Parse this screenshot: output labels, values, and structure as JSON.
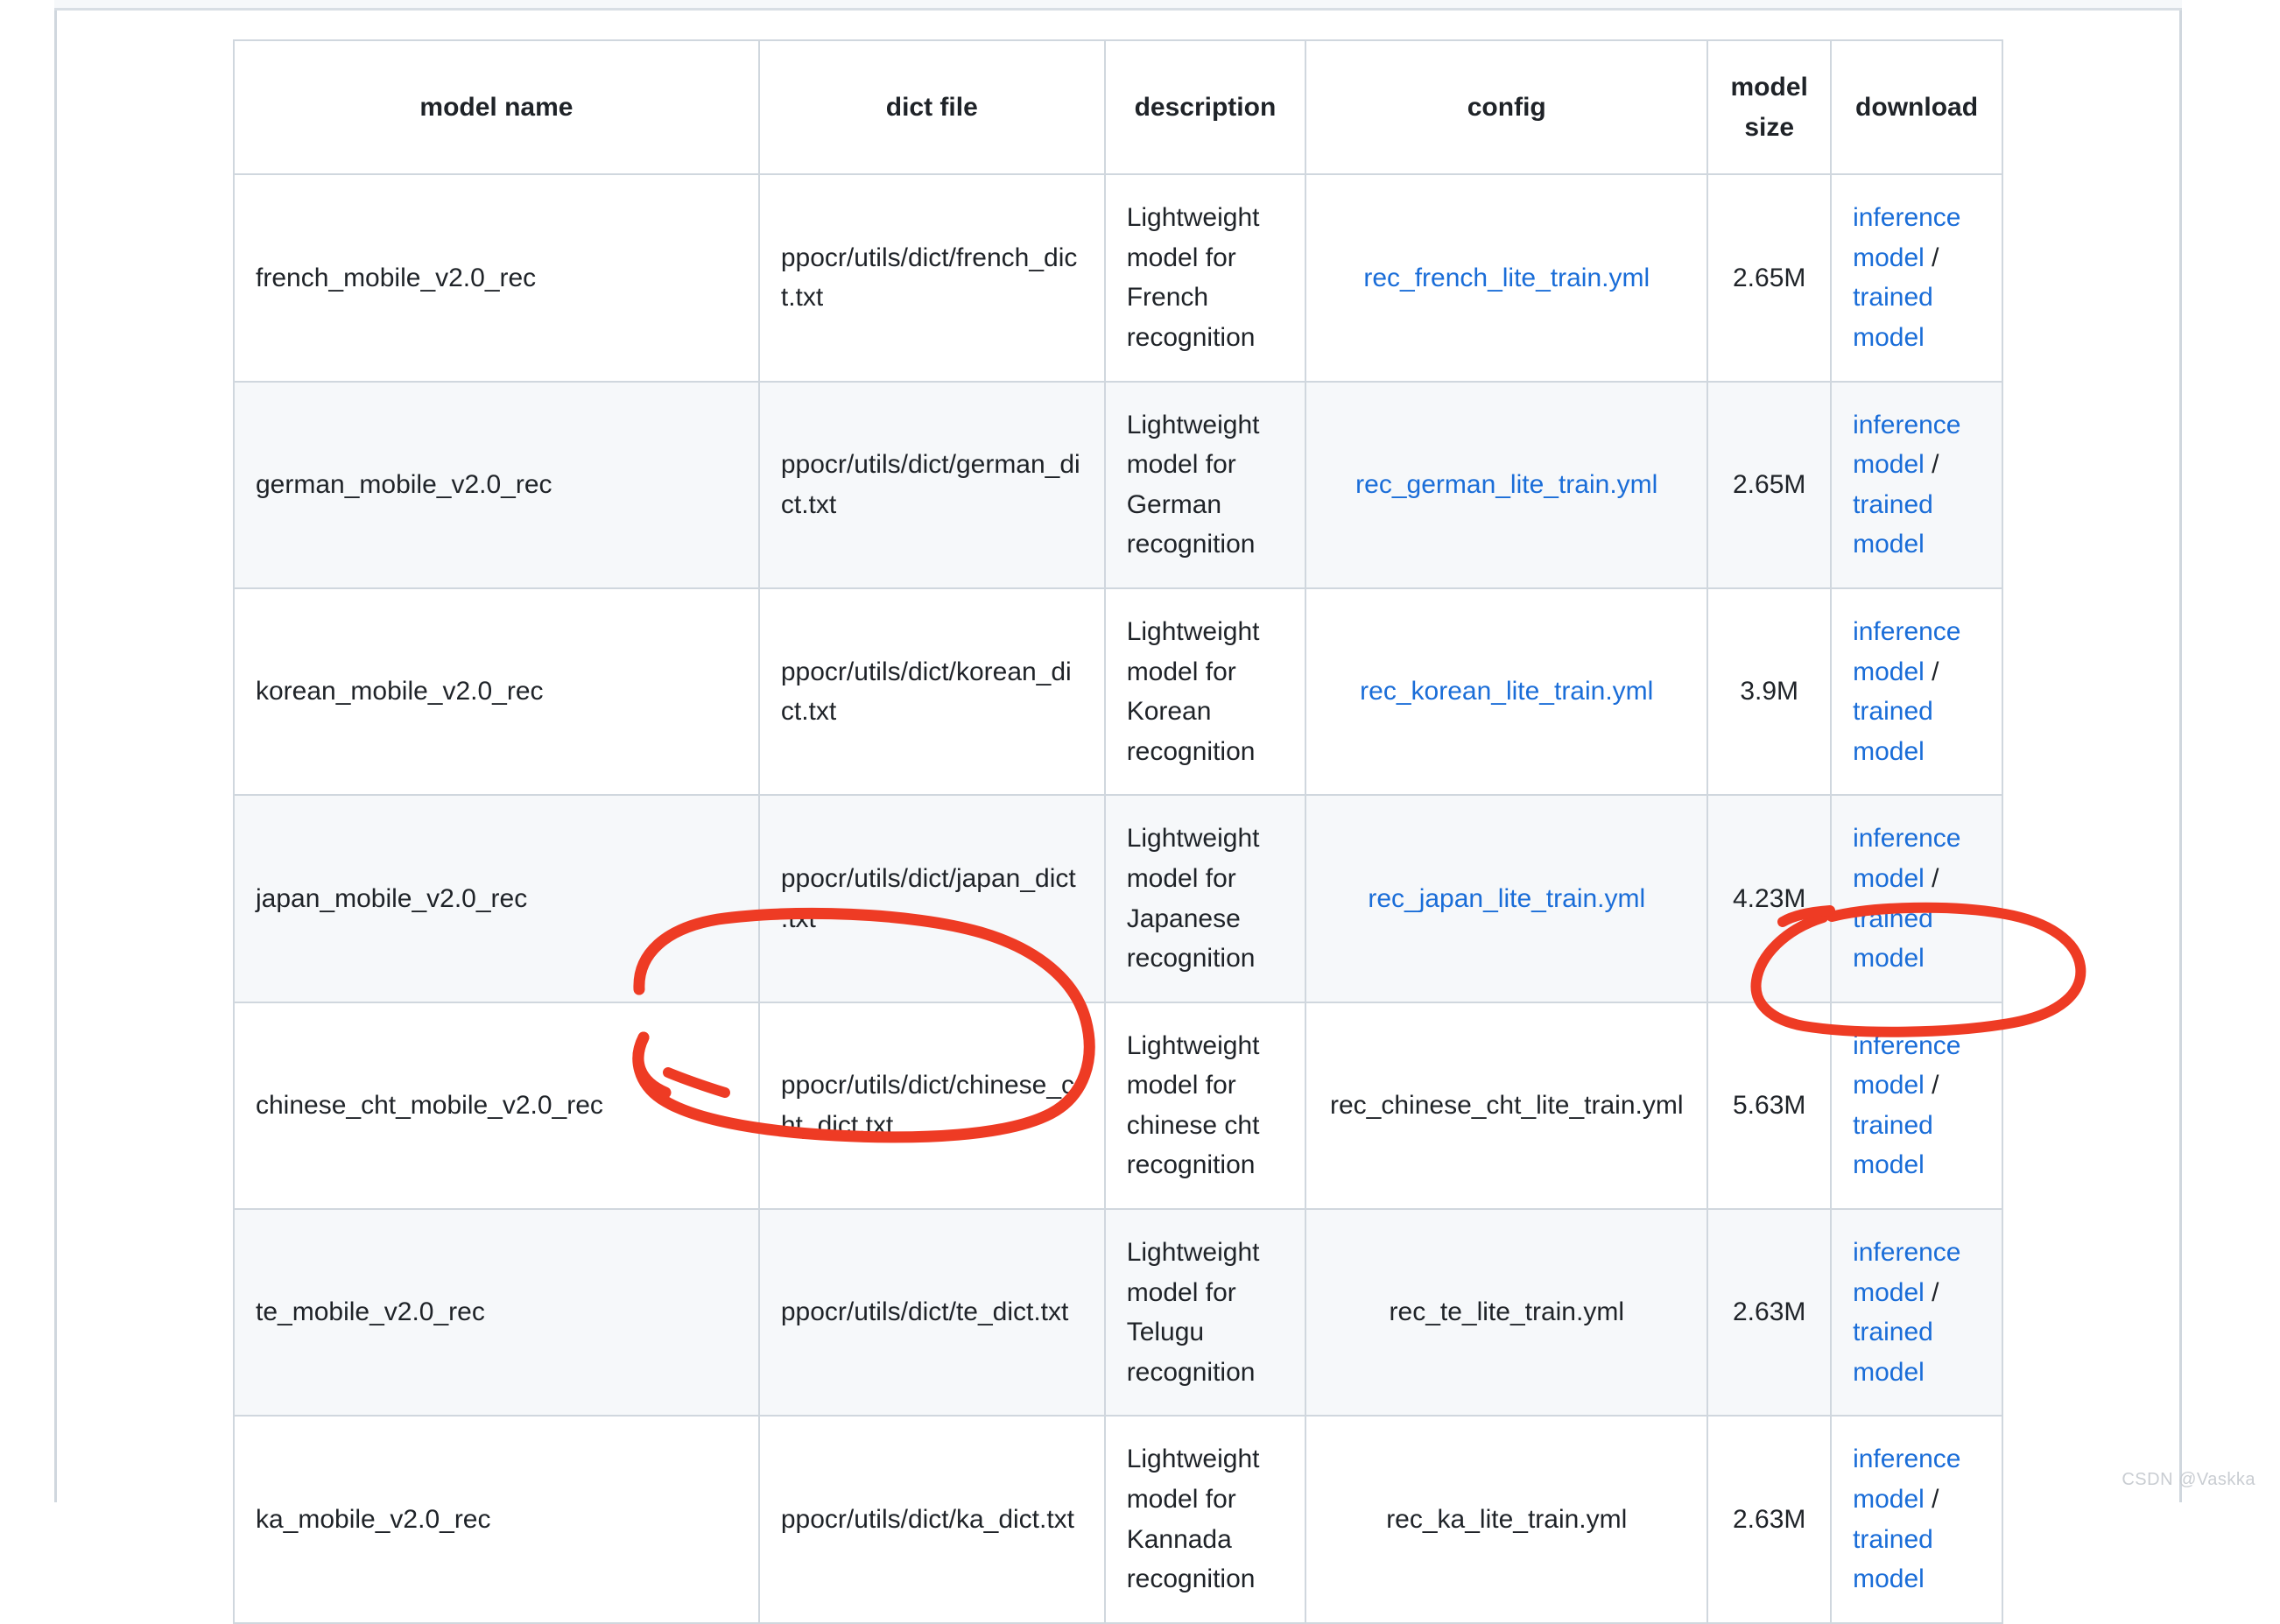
{
  "table": {
    "headers": [
      "model name",
      "dict file",
      "description",
      "config",
      "model size",
      "download"
    ],
    "download_labels": {
      "inference": "inference model",
      "separator": "/",
      "trained": "trained model"
    },
    "rows": [
      {
        "model_name": "french_mobile_v2.0_rec",
        "dict_file": "ppocr/utils/dict/french_dict.txt",
        "description": "Lightweight model for French recognition",
        "config": "rec_french_lite_train.yml",
        "config_is_link": true,
        "model_size": "2.65M",
        "download_inference": "inference model",
        "download_trained": "trained model"
      },
      {
        "model_name": "german_mobile_v2.0_rec",
        "dict_file": "ppocr/utils/dict/german_dict.txt",
        "description": "Lightweight model for German recognition",
        "config": "rec_german_lite_train.yml",
        "config_is_link": true,
        "model_size": "2.65M",
        "download_inference": "inference model",
        "download_trained": "trained model"
      },
      {
        "model_name": "korean_mobile_v2.0_rec",
        "dict_file": "ppocr/utils/dict/korean_dict.txt",
        "description": "Lightweight model for Korean recognition",
        "config": "rec_korean_lite_train.yml",
        "config_is_link": true,
        "model_size": "3.9M",
        "download_inference": "inference model",
        "download_trained": "trained model"
      },
      {
        "model_name": "japan_mobile_v2.0_rec",
        "dict_file": "ppocr/utils/dict/japan_dict.txt",
        "description": "Lightweight model for Japanese recognition",
        "config": "rec_japan_lite_train.yml",
        "config_is_link": true,
        "model_size": "4.23M",
        "download_inference": "inference model",
        "download_trained": "trained model"
      },
      {
        "model_name": "chinese_cht_mobile_v2.0_rec",
        "dict_file": "ppocr/utils/dict/chinese_cht_dict.txt",
        "description": "Lightweight model for chinese cht recognition",
        "config": "rec_chinese_cht_lite_train.yml",
        "config_is_link": false,
        "model_size": "5.63M",
        "download_inference": "inference model",
        "download_trained": "trained model"
      },
      {
        "model_name": "te_mobile_v2.0_rec",
        "dict_file": "ppocr/utils/dict/te_dict.txt",
        "description": "Lightweight model for Telugu recognition",
        "config": "rec_te_lite_train.yml",
        "config_is_link": false,
        "model_size": "2.63M",
        "download_inference": "inference model",
        "download_trained": "trained model"
      },
      {
        "model_name": "ka_mobile_v2.0_rec",
        "dict_file": "ppocr/utils/dict/ka_dict.txt",
        "description": "Lightweight model for Kannada recognition",
        "config": "rec_ka_lite_train.yml",
        "config_is_link": false,
        "model_size": "2.63M",
        "download_inference": "inference model",
        "download_trained": "trained model"
      }
    ]
  },
  "annotations": {
    "stroke_color": "#ee3b24",
    "items": [
      {
        "name": "dict-file-circle",
        "target": "chinese_cht dict file cell"
      },
      {
        "name": "inference-model-circle",
        "target": "chinese_cht inference model link"
      }
    ]
  },
  "watermark": {
    "text": "CSDN @Vaskka"
  },
  "colors": {
    "link": "#1a6dd8",
    "text": "#1f2328",
    "border": "#d0d7de",
    "stripe": "#f6f8fa",
    "annotation": "#ee3b24"
  }
}
